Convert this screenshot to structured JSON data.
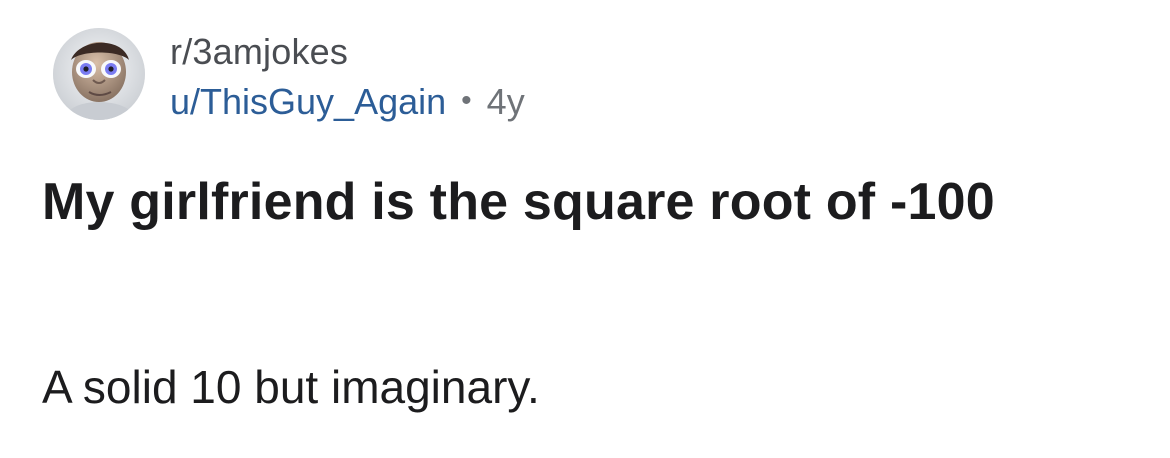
{
  "post": {
    "subreddit": "r/3amjokes",
    "username": "u/ThisGuy_Again",
    "separator": "•",
    "age": "4y",
    "title": "My girlfriend is the square root of -100",
    "body": "A solid 10 but imaginary."
  },
  "avatar": {
    "icon": "cartoon-face-avatar"
  },
  "colors": {
    "subreddit_text": "#4a4d52",
    "username_text": "#2c5d97",
    "meta_text": "#6f7378",
    "title_text": "#1c1c1e",
    "background": "#ffffff"
  }
}
